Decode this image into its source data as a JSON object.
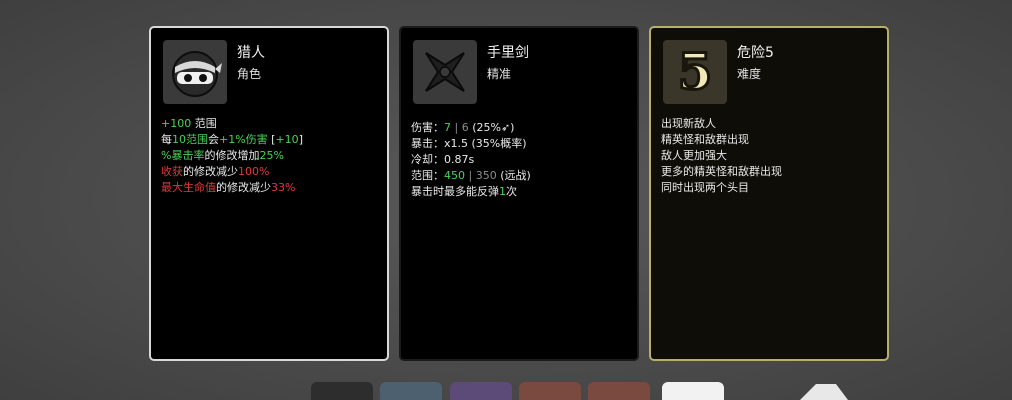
{
  "cards": [
    {
      "icon": "ninja-head-icon",
      "title": "猎人",
      "subtitle": "角色",
      "lines": [
        [
          {
            "t": "+100",
            "c": "g"
          },
          {
            "t": " 范围",
            "c": ""
          }
        ],
        [
          {
            "t": "每",
            "c": ""
          },
          {
            "t": "10",
            "c": "g"
          },
          {
            "t": "范围",
            "c": "g"
          },
          {
            "t": "会",
            "c": ""
          },
          {
            "t": "+1%伤害",
            "c": "g"
          },
          {
            "t": " [",
            "c": ""
          },
          {
            "t": "+10",
            "c": "g"
          },
          {
            "t": "]",
            "c": ""
          }
        ],
        [
          {
            "t": "%暴击率",
            "c": "g"
          },
          {
            "t": "的修改增加",
            "c": ""
          },
          {
            "t": "25%",
            "c": "g"
          }
        ],
        [
          {
            "t": "收获",
            "c": "r"
          },
          {
            "t": "的修改减少",
            "c": ""
          },
          {
            "t": "100%",
            "c": "r"
          }
        ],
        [
          {
            "t": "最大生命值",
            "c": "r"
          },
          {
            "t": "的修改减少",
            "c": ""
          },
          {
            "t": "33%",
            "c": "r"
          }
        ]
      ]
    },
    {
      "icon": "shuriken-icon",
      "title": "手里剑",
      "subtitle": "精准",
      "lines": [
        [
          {
            "t": "伤害：",
            "c": ""
          },
          {
            "t": "7",
            "c": "g"
          },
          {
            "t": " | 6 ",
            "c": "dim"
          },
          {
            "t": "(25%",
            "c": ""
          },
          {
            "t": "➶",
            "c": ""
          },
          {
            "t": ")",
            "c": ""
          }
        ],
        [
          {
            "t": "暴击：x1.5  (35%概率)",
            "c": ""
          }
        ],
        [
          {
            "t": "冷却：0.87s",
            "c": ""
          }
        ],
        [
          {
            "t": "范围：",
            "c": ""
          },
          {
            "t": "450",
            "c": "g"
          },
          {
            "t": " | 350 ",
            "c": "dim"
          },
          {
            "t": " (远战)",
            "c": ""
          }
        ],
        [
          {
            "t": "暴击时最多能反弹",
            "c": ""
          },
          {
            "t": "1",
            "c": "g"
          },
          {
            "t": "次",
            "c": ""
          }
        ]
      ]
    },
    {
      "icon": "danger-5-icon",
      "icon_text": "5",
      "title": "危险5",
      "subtitle": "难度",
      "lines": [
        [
          {
            "t": "出现新敌人",
            "c": ""
          }
        ],
        [
          {
            "t": "精英怪和敌群出现",
            "c": ""
          }
        ],
        [
          {
            "t": "敌人更加强大",
            "c": ""
          }
        ],
        [
          {
            "t": "更多的精英怪和敌群出现",
            "c": ""
          }
        ],
        [
          {
            "t": "同时出现两个头目",
            "c": ""
          }
        ]
      ]
    }
  ],
  "bottom_slots": [
    {
      "name": "slot-1",
      "color": "#2d2d2d"
    },
    {
      "name": "slot-2",
      "color": "#4d6070"
    },
    {
      "name": "slot-3",
      "color": "#5c4a78"
    },
    {
      "name": "slot-4",
      "color": "#7a4a40"
    },
    {
      "name": "slot-5",
      "color": "#7a4a40"
    },
    {
      "name": "slot-6",
      "color": "#f2f2f2"
    }
  ]
}
